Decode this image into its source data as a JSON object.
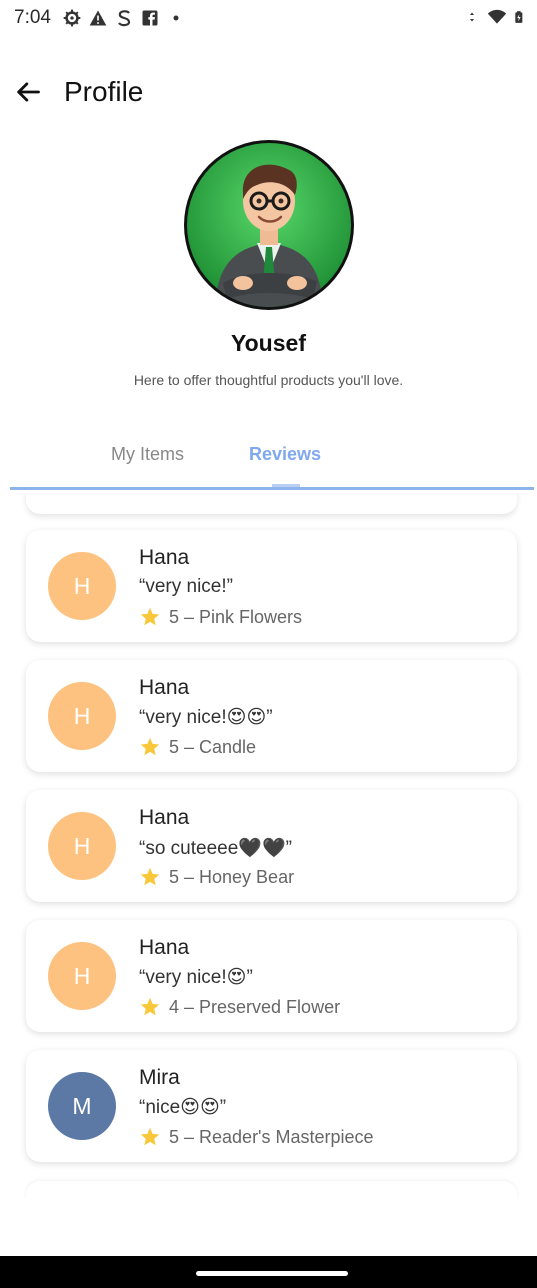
{
  "status_bar": {
    "time": "7:04"
  },
  "app_bar": {
    "title": "Profile"
  },
  "profile": {
    "name": "Yousef",
    "bio": "Here to offer thoughtful products you'll love."
  },
  "tabs": [
    {
      "label": "My Items",
      "active": false
    },
    {
      "label": "Reviews",
      "active": true
    }
  ],
  "reviews": [
    {
      "initial": "H",
      "name": "Hana",
      "text": "“very nice!”",
      "meta": "5 – Pink Flowers",
      "avatar_color": "#fdc27f"
    },
    {
      "initial": "H",
      "name": "Hana",
      "text": "“very nice!😍😍”",
      "meta": "5 – Candle",
      "avatar_color": "#fdc27f"
    },
    {
      "initial": "H",
      "name": "Hana",
      "text": "“so cuteeee🖤🖤”",
      "meta": "5 – Honey Bear",
      "avatar_color": "#fdc27f"
    },
    {
      "initial": "H",
      "name": "Hana",
      "text": "“very nice!😍”",
      "meta": "4 – Preserved Flower",
      "avatar_color": "#fdc27f"
    },
    {
      "initial": "M",
      "name": "Mira",
      "text": "“nice😍😍”",
      "meta": "5 – Reader's Masterpiece",
      "avatar_color": "#5c78a4"
    }
  ],
  "colors": {
    "accent": "#7fa8ee",
    "tab_inactive": "#888888",
    "star": "#f8c83a"
  },
  "icons": {
    "back": "arrow-left-icon",
    "star": "star-icon"
  }
}
